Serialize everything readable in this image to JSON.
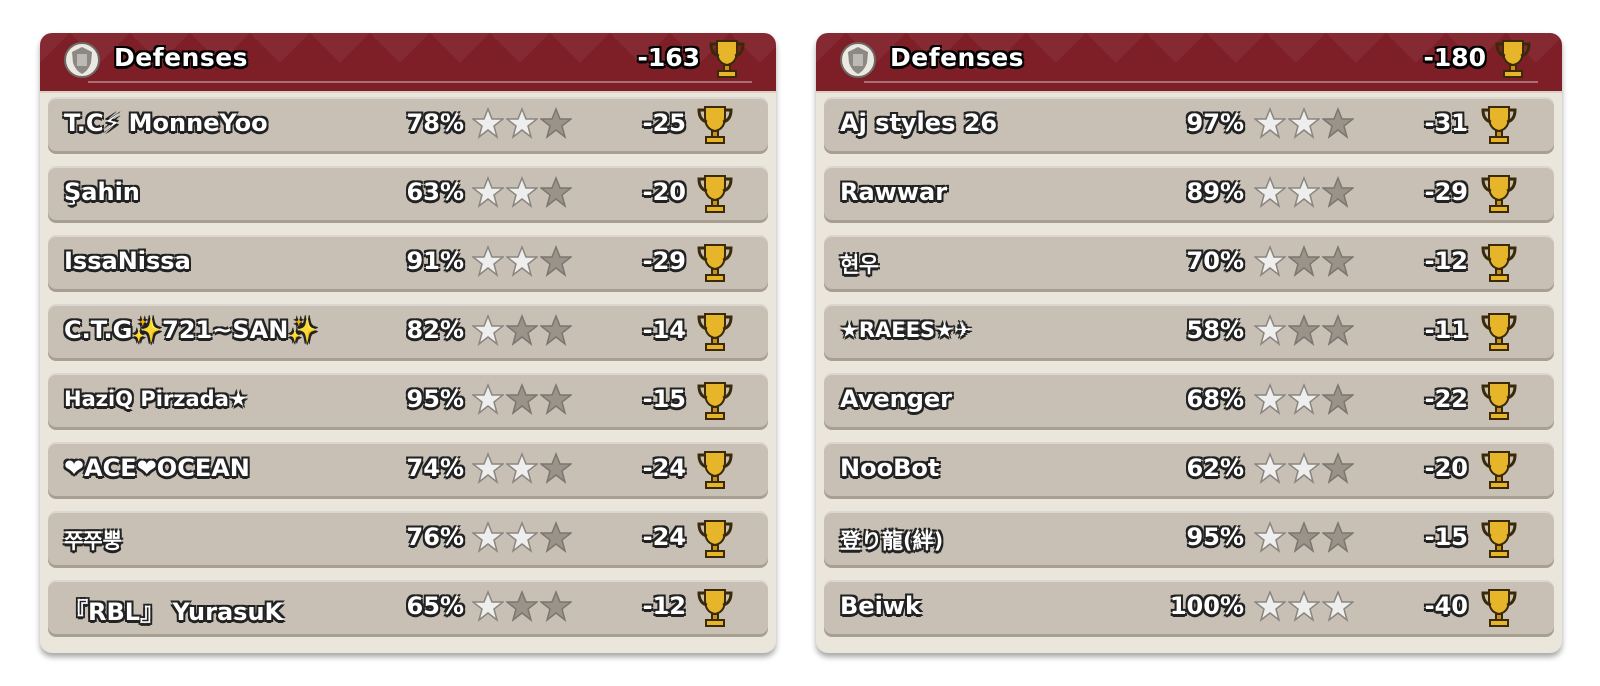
{
  "panels": [
    {
      "title": "Defenses",
      "total": "-163",
      "rows": [
        {
          "name": "T.C⚡ MonneYoo",
          "percent": "78%",
          "stars": 2,
          "trophies": "-25"
        },
        {
          "name": "Şahin",
          "percent": "63%",
          "stars": 2,
          "trophies": "-20"
        },
        {
          "name": "IssaNissa",
          "percent": "91%",
          "stars": 2,
          "trophies": "-29"
        },
        {
          "name": "C.T.G✨721~SAN✨",
          "percent": "82%",
          "stars": 1,
          "trophies": "-14"
        },
        {
          "name": "HaziQ Pirzada★",
          "percent": "95%",
          "stars": 1,
          "trophies": "-15"
        },
        {
          "name": "❤ACE❤OCEAN",
          "percent": "74%",
          "stars": 2,
          "trophies": "-24"
        },
        {
          "name": "쭈쭈뿡",
          "percent": "76%",
          "stars": 2,
          "trophies": "-24"
        },
        {
          "name": "『RBL』 YurasuK",
          "percent": "65%",
          "stars": 1,
          "trophies": "-12"
        }
      ]
    },
    {
      "title": "Defenses",
      "total": "-180",
      "rows": [
        {
          "name": "Aj styles 26",
          "percent": "97%",
          "stars": 2,
          "trophies": "-31"
        },
        {
          "name": "Rawwar",
          "percent": "89%",
          "stars": 2,
          "trophies": "-29"
        },
        {
          "name": "현우",
          "percent": "70%",
          "stars": 1,
          "trophies": "-12"
        },
        {
          "name": "★RAEES★✈",
          "percent": "58%",
          "stars": 1,
          "trophies": "-11"
        },
        {
          "name": "Avenger",
          "percent": "68%",
          "stars": 2,
          "trophies": "-22"
        },
        {
          "name": "NooBot",
          "percent": "62%",
          "stars": 2,
          "trophies": "-20"
        },
        {
          "name": "登り龍(絆)",
          "percent": "95%",
          "stars": 1,
          "trophies": "-15"
        },
        {
          "name": "Beiwk",
          "percent": "100%",
          "stars": 3,
          "trophies": "-40"
        }
      ]
    }
  ],
  "colors": {
    "header_bg": "#7e1f27",
    "panel_bg": "#ebe6dc",
    "row_bg": "#c8c0b5",
    "star_earned": "#eeeeee",
    "star_empty": "#9a938a",
    "trophy_gold": "#d9a520"
  },
  "icons": {
    "header": "shield-icon",
    "trophy": "trophy-icon",
    "star": "star-icon"
  }
}
